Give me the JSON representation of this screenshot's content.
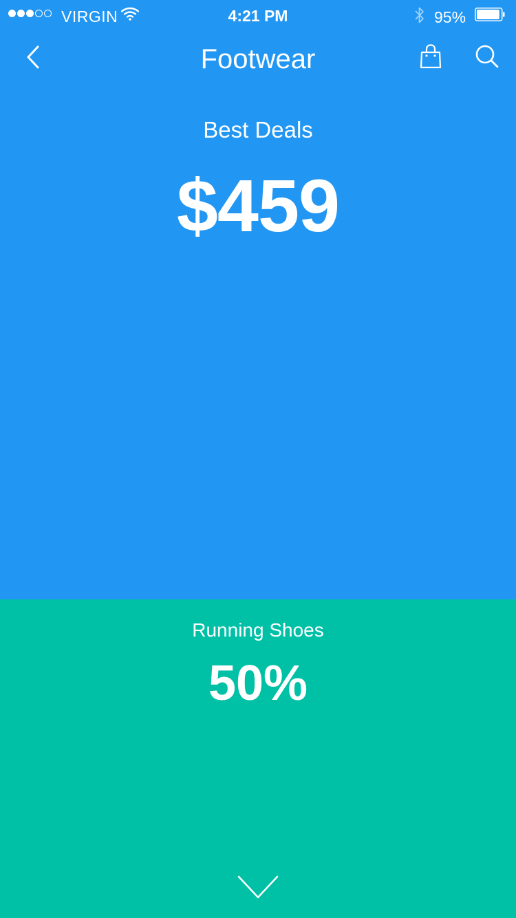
{
  "status_bar": {
    "carrier": "VIRGIN",
    "time": "4:21 PM",
    "battery_percent": "95%",
    "signal_bars_filled": 3,
    "signal_bars_total": 5,
    "battery_level": 0.95
  },
  "nav": {
    "title": "Footwear",
    "back_icon": "chevron-left-icon",
    "bag_icon": "shopping-bag-icon",
    "search_icon": "search-icon"
  },
  "deals": {
    "label": "Best Deals",
    "price": "$459"
  },
  "running_shoes": {
    "label": "Running Shoes",
    "value": "50%"
  },
  "colors": {
    "top_bg": "#2196F3",
    "bottom_bg": "#00C1A6",
    "text": "#FFFFFF"
  }
}
